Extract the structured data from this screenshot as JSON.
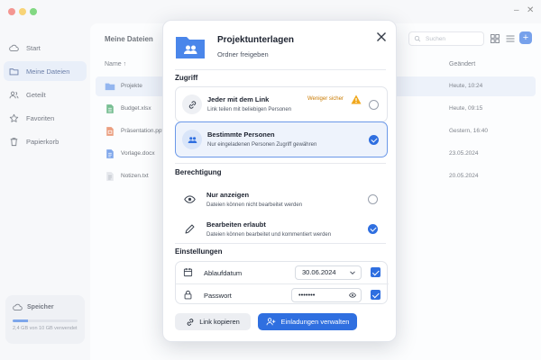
{
  "colors": {
    "accent": "#2f6fe0",
    "warning": "#c97a00",
    "selected_row": "#e4ebf7"
  },
  "sidebar": {
    "items": [
      {
        "label": "Start",
        "icon": "cloud-icon"
      },
      {
        "label": "Meine Dateien",
        "icon": "folder-icon",
        "active": true
      },
      {
        "label": "Geteilt",
        "icon": "users-icon"
      },
      {
        "label": "Favoriten",
        "icon": "star-icon"
      },
      {
        "label": "Papierkorb",
        "icon": "trash-icon"
      }
    ],
    "storage": {
      "title": "Speicher",
      "usage_text": "2,4 GB von 10 GB verwendet",
      "used_fraction": 0.24
    }
  },
  "main": {
    "title": "Meine Dateien",
    "search_placeholder": "Suchen",
    "columns": {
      "name": "Name",
      "modified": "Geändert"
    },
    "files": [
      {
        "name": "Projekte",
        "modified": "Heute, 10:24",
        "icon": "folder-icon"
      },
      {
        "name": "Budget.xlsx",
        "modified": "Heute, 09:15",
        "icon": "spreadsheet-icon"
      },
      {
        "name": "Präsentation.pptx",
        "modified": "Gestern, 16:40",
        "icon": "presentation-icon"
      },
      {
        "name": "Vorlage.docx",
        "modified": "23.05.2024",
        "icon": "document-icon"
      },
      {
        "name": "Notizen.txt",
        "modified": "20.05.2024",
        "icon": "text-file-icon"
      }
    ]
  },
  "dialog": {
    "title": "Projektunterlagen",
    "subtitle": "Ordner freigeben",
    "access_heading": "Zugriff",
    "access_options": [
      {
        "label": "Jeder mit dem Link",
        "description": "Link teilen mit beliebigen Personen",
        "badge": "Weniger sicher",
        "selected": false
      },
      {
        "label": "Bestimmte Personen",
        "description": "Nur eingeladenen Personen Zugriff gewähren",
        "selected": true
      }
    ],
    "permission_heading": "Berechtigung",
    "permissions": [
      {
        "label": "Nur anzeigen",
        "description": "Dateien können nicht bearbeitet werden",
        "selected": false
      },
      {
        "label": "Bearbeiten erlaubt",
        "description": "Dateien können bearbeitet und kommentiert werden",
        "selected": true
      }
    ],
    "settings_heading": "Einstellungen",
    "settings": {
      "expiry": {
        "label": "Ablaufdatum",
        "value": "30.06.2024",
        "enabled": true
      },
      "password": {
        "label": "Passwort",
        "value": "•••••••",
        "enabled": true
      }
    },
    "buttons": {
      "copy_link": "Link kopieren",
      "manage_invitations": "Einladungen verwalten"
    }
  }
}
